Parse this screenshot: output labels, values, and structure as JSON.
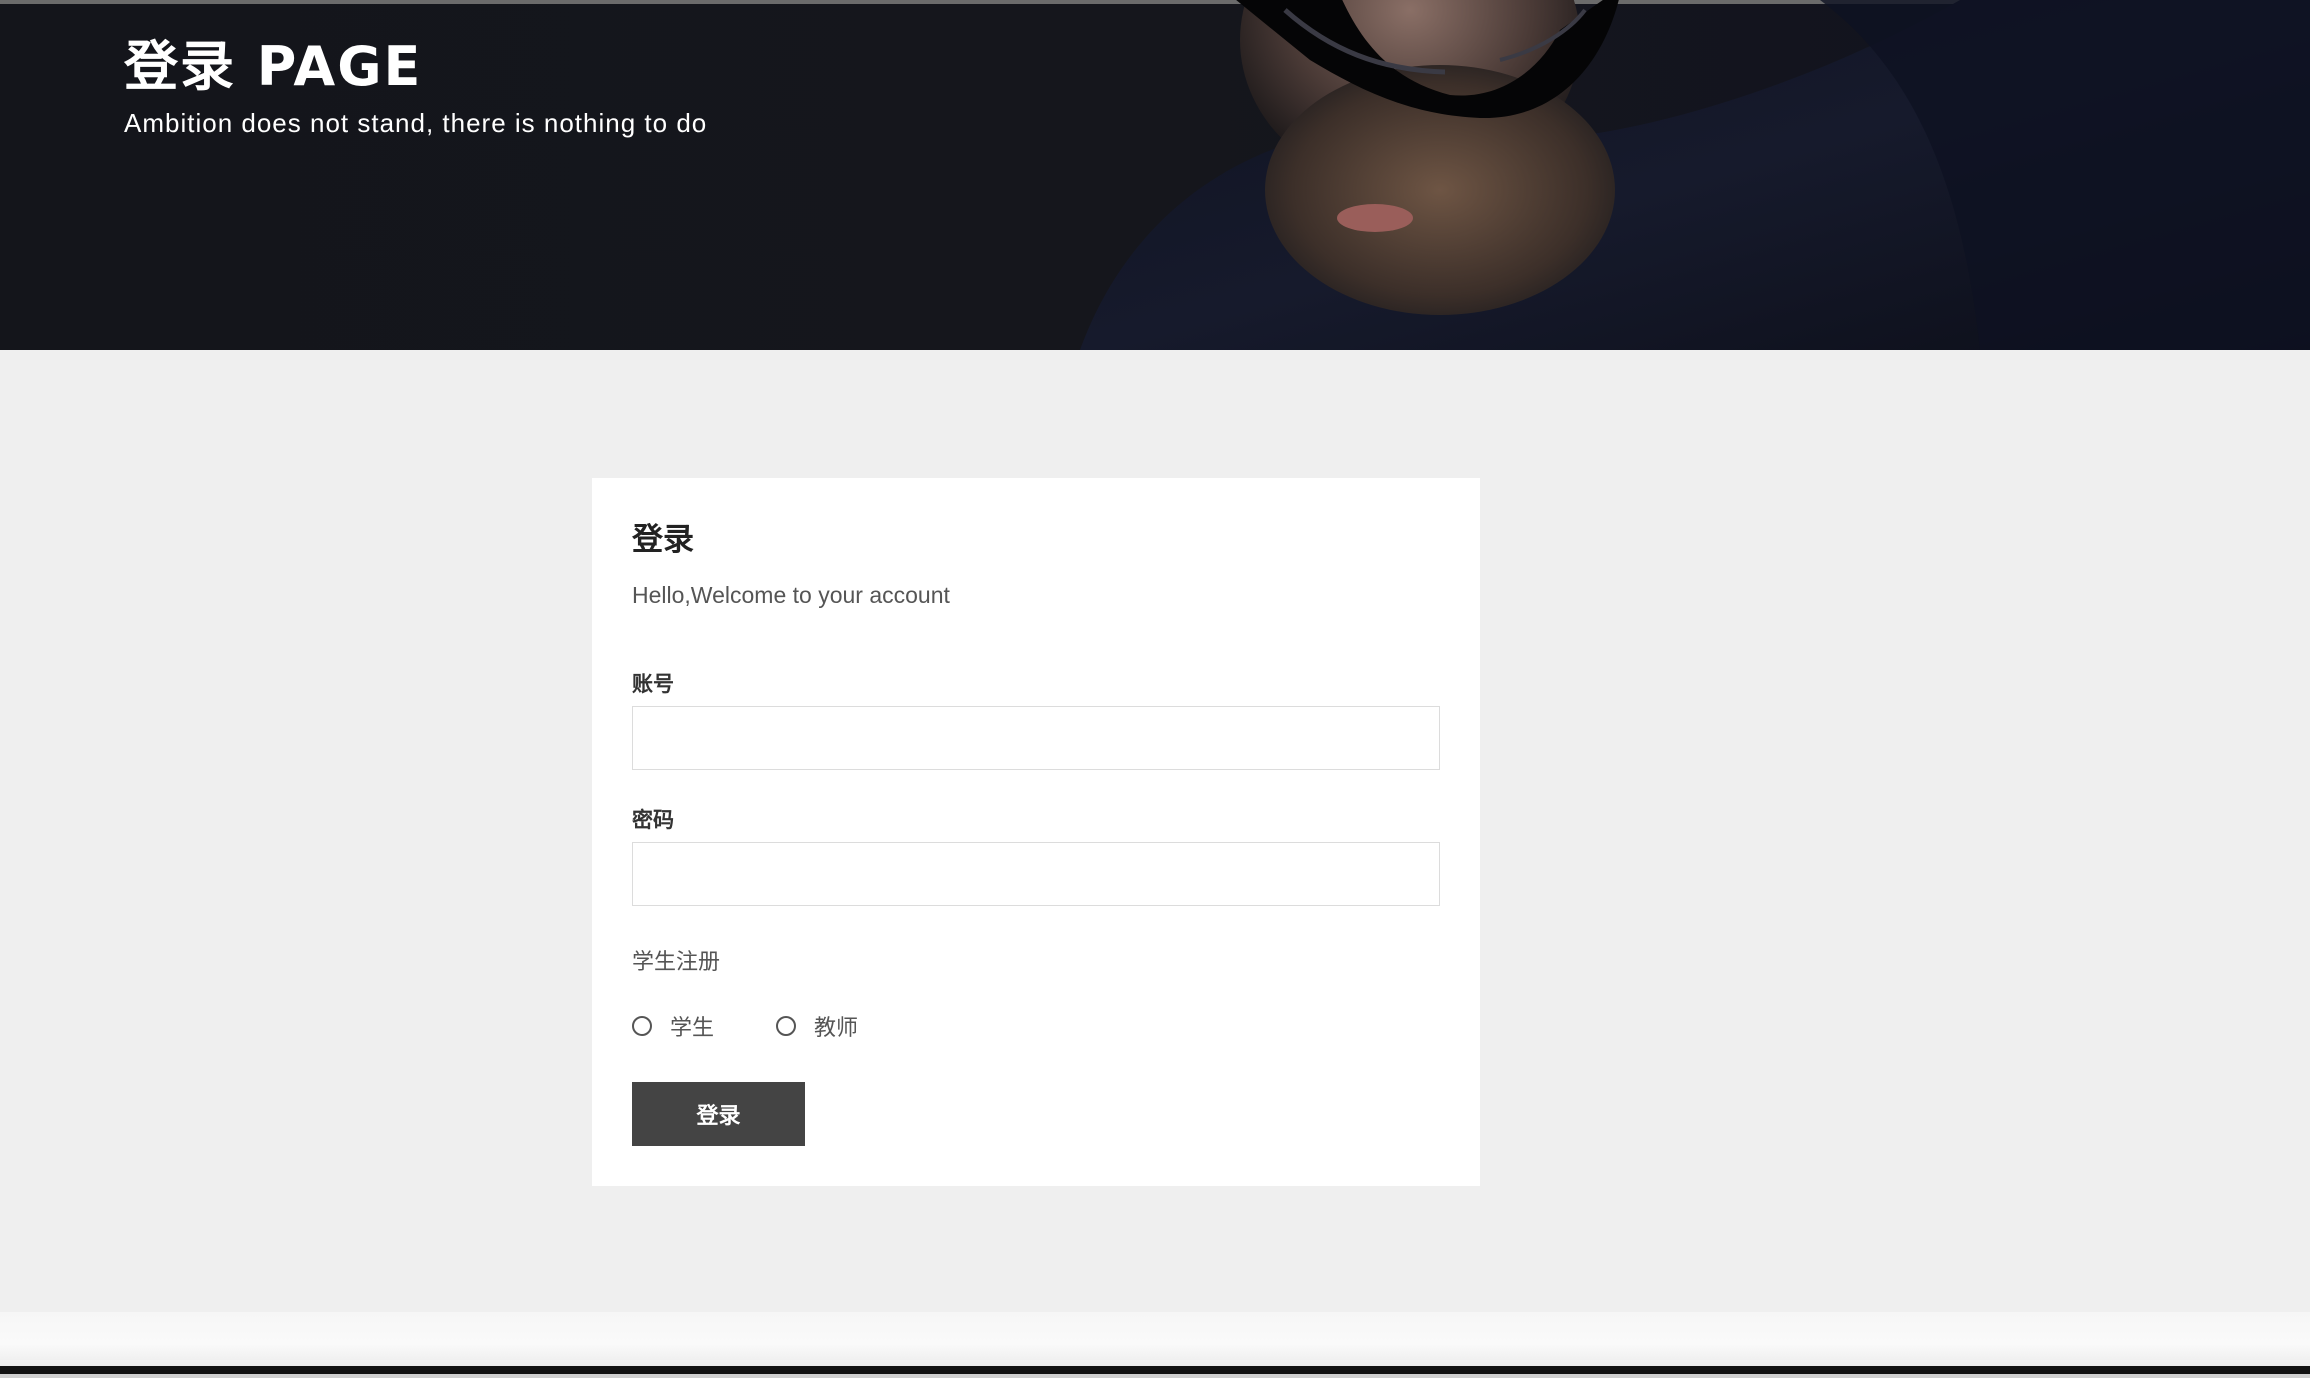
{
  "hero": {
    "title": "登录 PAGE",
    "subtitle": "Ambition does not stand, there is nothing to do"
  },
  "login_form": {
    "title": "登录",
    "welcome": "Hello,Welcome to your account",
    "account_label": "账号",
    "account_value": "",
    "password_label": "密码",
    "password_value": "",
    "register_label": "学生注册",
    "roles": [
      "学生",
      "教师"
    ],
    "submit_label": "登录"
  },
  "colors": {
    "page_bg": "#efefef",
    "hero_bg": "#15161c",
    "card_bg": "#ffffff",
    "button_bg": "#444444",
    "button_text": "#ffffff"
  },
  "icons": {
    "hero_image": "man-with-sunglasses-photo",
    "role_selector": "radio-circle"
  }
}
